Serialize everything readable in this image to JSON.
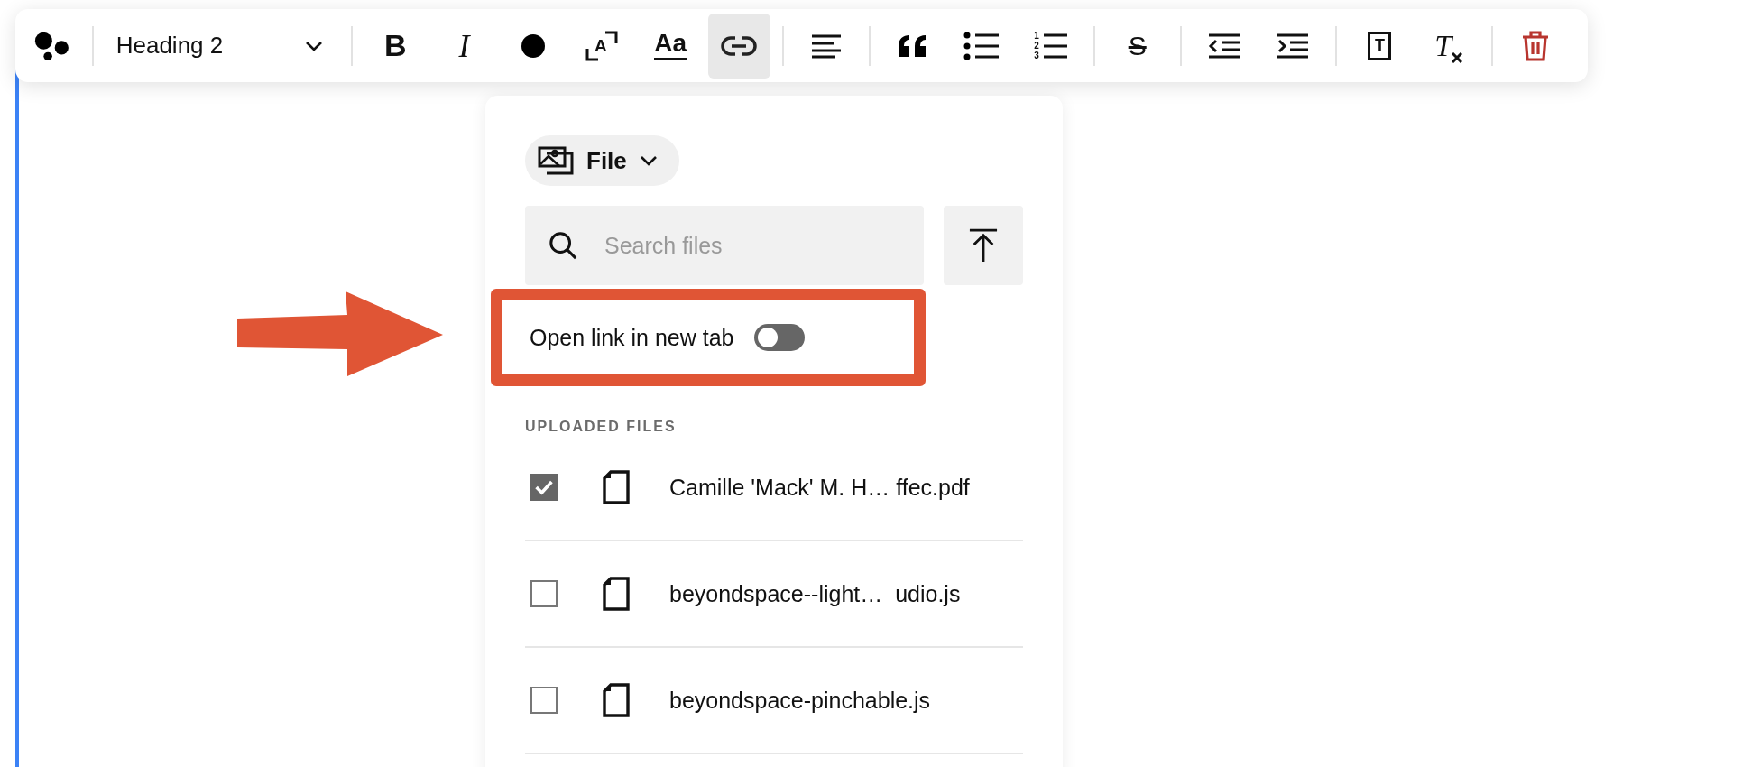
{
  "toolbar": {
    "block_style": "Heading 2",
    "items": [
      {
        "kind": "bold",
        "glyph": "B",
        "selected": false
      },
      {
        "kind": "italic",
        "glyph": "I",
        "selected": false
      },
      {
        "kind": "color",
        "selected": false
      },
      {
        "kind": "size",
        "glyph": "A",
        "selected": false
      },
      {
        "kind": "font",
        "glyph": "Aa",
        "selected": false
      },
      {
        "kind": "link",
        "selected": true
      },
      {
        "kind": "divider"
      },
      {
        "kind": "align",
        "selected": false
      },
      {
        "kind": "divider"
      },
      {
        "kind": "quote",
        "selected": false
      },
      {
        "kind": "bullets",
        "selected": false
      },
      {
        "kind": "numbered",
        "glyph": "123",
        "selected": false
      },
      {
        "kind": "divider"
      },
      {
        "kind": "strike",
        "glyph": "S",
        "selected": false
      },
      {
        "kind": "divider"
      },
      {
        "kind": "outdent",
        "selected": false
      },
      {
        "kind": "indent",
        "selected": false
      },
      {
        "kind": "divider"
      },
      {
        "kind": "clipboard",
        "glyph": "T",
        "selected": false
      },
      {
        "kind": "clear",
        "glyph": "T",
        "selected": false
      },
      {
        "kind": "divider"
      },
      {
        "kind": "delete",
        "selected": false
      }
    ]
  },
  "panel": {
    "source": "File",
    "search": {
      "placeholder": "Search files"
    },
    "open_in_new_tab": {
      "label": "Open link in new tab",
      "on": false
    },
    "section_title": "UPLOADED FILES",
    "files": [
      {
        "name": "Camille 'Mack' M. H… ffec.pdf",
        "checked": true
      },
      {
        "name": "beyondspace--light…  udio.js",
        "checked": false
      },
      {
        "name": "beyondspace-pinchable.js",
        "checked": false
      }
    ]
  }
}
